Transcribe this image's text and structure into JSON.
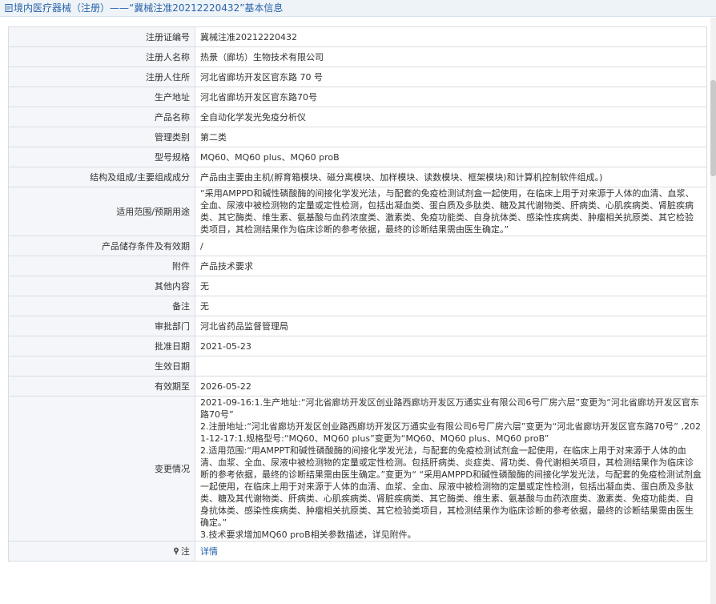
{
  "header": {
    "title": "境内医疗器械（注册）——“冀械注准20212220432”基本信息"
  },
  "rows": [
    {
      "label": "注册证编号",
      "value": "冀械注准20212220432"
    },
    {
      "label": "注册人名称",
      "value": "热景（廊坊）生物技术有限公司"
    },
    {
      "label": "注册人住所",
      "value": "河北省廊坊开发区官东路 70 号"
    },
    {
      "label": "生产地址",
      "value": "河北省廊坊开发区官东路70号"
    },
    {
      "label": "产品名称",
      "value": "全自动化学发光免疫分析仪"
    },
    {
      "label": "管理类别",
      "value": "第二类"
    },
    {
      "label": "型号规格",
      "value": "MQ60、MQ60 plus、MQ60 proB"
    },
    {
      "label": "结构及组成/主要组成成分",
      "value": "产品由主要由主机(孵育箱模块、磁分离模块、加样模块、读数模块、框架模块)和计算机控制软件组成。)"
    },
    {
      "label": "适用范围/预期用途",
      "value": "“采用AMPPD和碱性磷酸酶的间接化学发光法，与配套的免疫检测试剂盒一起使用，在临床上用于对来源于人体的血清、血浆、全血、尿液中被检测物的定量或定性检测，包括出凝血类、蛋白质及多肽类、糖及其代谢物类、肝病类、心肌疾病类、肾脏疾病类、其它酶类、维生素、氨基酸与血药浓度类、激素类、免疫功能类、自身抗体类、感染性疾病类、肿瘤相关抗原类、其它检验类项目，其检测结果作为临床诊断的参考依据，最终的诊断结果需由医生确定。”"
    },
    {
      "label": "产品储存条件及有效期",
      "value": "/"
    },
    {
      "label": "附件",
      "value": "产品技术要求"
    },
    {
      "label": "其他内容",
      "value": "无"
    },
    {
      "label": "备注",
      "value": "无"
    },
    {
      "label": "审批部门",
      "value": "河北省药品监督管理局"
    },
    {
      "label": "批准日期",
      "value": "2021-05-23"
    },
    {
      "label": "生效日期",
      "value": ""
    },
    {
      "label": "有效期至",
      "value": "2026-05-22"
    }
  ],
  "changes": {
    "label": "变更情况",
    "lines": [
      "2021-09-16:1.生产地址:“河北省廊坊开发区创业路西廊坊开发区万通实业有限公司6号厂房六层”变更为“河北省廊坊开发区官东路70号”",
      "2.注册地址:“河北省廊坊开发区创业路西廊坊开发区万通实业有限公司6号厂房六层”变更为“河北省廊坊开发区官东路70号” ,2021-12-17:1.规格型号:“MQ60、MQ60 plus”变更为“MQ60、MQ60 plus、MQ60 proB”",
      "2.适用范围:“用AMPPT和碱性磷酸酶的间接化学发光法，与配套的免疫检测试剂盒一起使用，在临床上用于对来源于人体的血清、血浆、全血、尿液中被检测物的定量或定性检测。包括肝病类、炎症类、肾功类、骨代谢相关项目，其检测结果作为临床诊断的参考依据，最终的诊断结果需由医生确定。”变更为“ “采用AMPPD和碱性磷酸酶的间接化学发光法，与配套的免疫检测试剂盒一起使用，在临床上用于对来源于人体的血清、血浆、全血、尿液中被检测物的定量或定性检测，包括出凝血类、蛋白质及多肽类、糖及其代谢物类、肝病类、心肌疾病类、肾脏疾病类、其它酶类、维生素、氨基酸与血药浓度类、激素类、免疫功能类、自身抗体类、感染性疾病类、肿瘤相关抗原类、其它检验类项目，其检测结果作为临床诊断的参考依据，最终的诊断结果需由医生确定。”",
      "3.技术要求增加MQ60 proB相关参数描述，详见附件。"
    ]
  },
  "note_row": {
    "label": "注",
    "link": "详情"
  },
  "colors": {
    "title": "#2a64a8",
    "label_bg": "#f4f6f9",
    "border": "#d8dde3",
    "link": "#1d5fa8"
  }
}
